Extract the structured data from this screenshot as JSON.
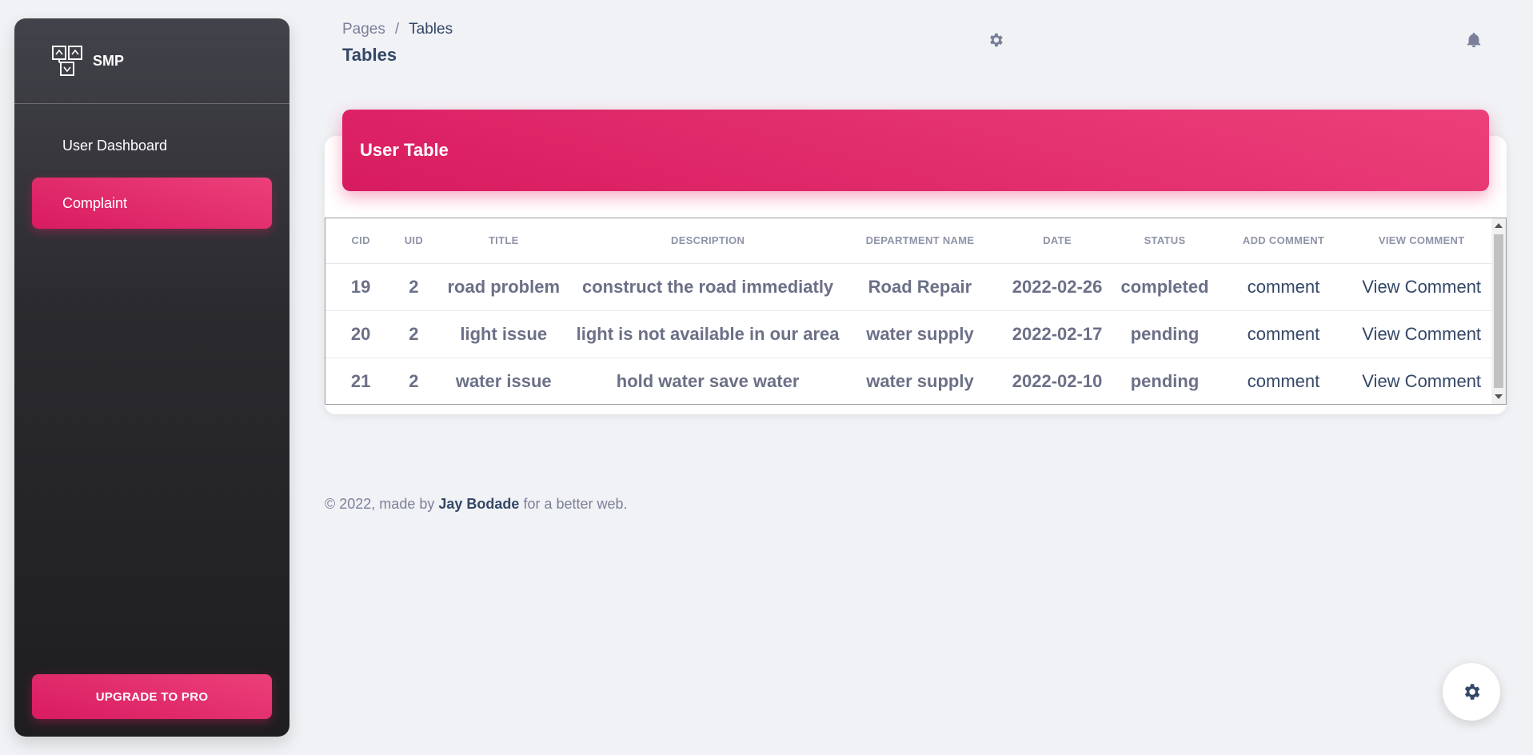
{
  "sidebar": {
    "brand": "SMP",
    "items": [
      {
        "label": "User Dashboard"
      },
      {
        "label": "Complaint"
      }
    ],
    "upgrade_label": "UPGRADE TO PRO"
  },
  "header": {
    "breadcrumb_root": "Pages",
    "breadcrumb_sep": "/",
    "breadcrumb_current": "Tables",
    "title": "Tables"
  },
  "card": {
    "title": "User Table",
    "columns": [
      "CID",
      "UID",
      "TITLE",
      "DESCRIPTION",
      "DEPARTMENT NAME",
      "DATE",
      "STATUS",
      "ADD COMMENT",
      "VIEW COMMENT"
    ],
    "rows": [
      [
        "19",
        "2",
        "road problem",
        "construct the road immediatly",
        "Road Repair",
        "2022-02-26",
        "completed",
        "comment",
        "View Comment"
      ],
      [
        "20",
        "2",
        "light issue",
        "light is not available in our area",
        "water supply",
        "2022-02-17",
        "pending",
        "comment",
        "View Comment"
      ],
      [
        "21",
        "2",
        "water issue",
        "hold water save water",
        "water supply",
        "2022-02-10",
        "pending",
        "comment",
        "View Comment"
      ]
    ]
  },
  "footer": {
    "prefix": "© 2022, made by",
    "author": "Jay Bodade",
    "suffix": "for a better web."
  },
  "icons": {
    "settings": "gear-icon",
    "notifications": "bell-icon",
    "configurator": "gear-icon"
  },
  "colors": {
    "accent": "#e91e63",
    "sidebar_dark": "#1e1e20"
  }
}
